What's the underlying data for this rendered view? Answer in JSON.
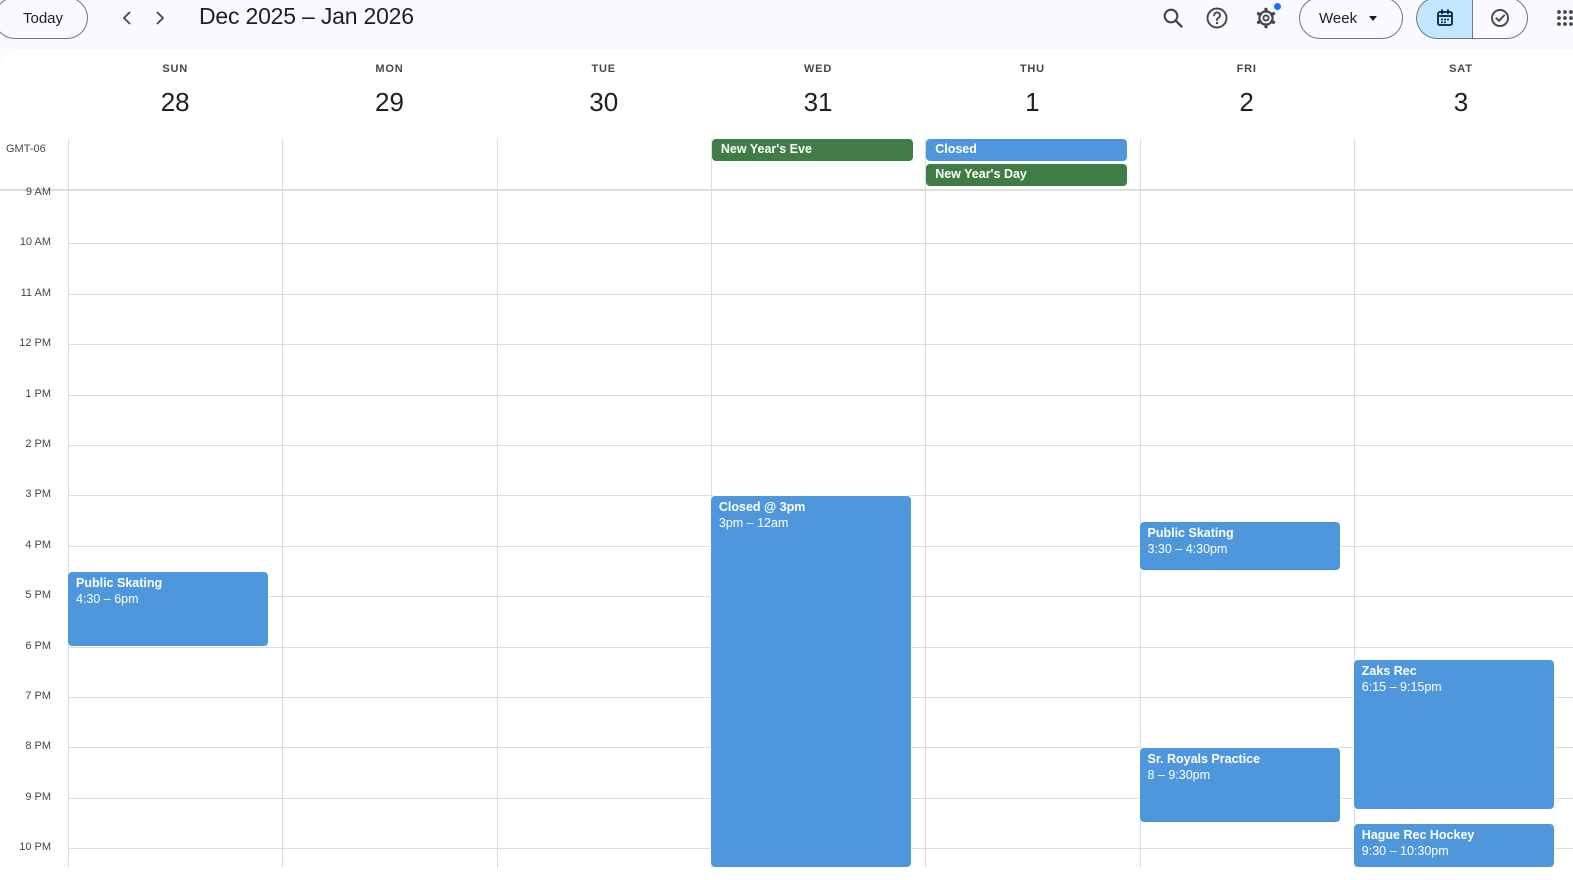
{
  "toolbar": {
    "today_label": "Today",
    "date_range": "Dec 2025 – Jan 2026",
    "view_label": "Week",
    "icons": {
      "prev": "chevron-left-icon",
      "next": "chevron-right-icon",
      "search": "search-icon",
      "help": "help-icon",
      "settings": "gear-icon",
      "calendar": "calendar-icon",
      "tasks": "check-circle-icon",
      "apps": "apps-grid-icon"
    }
  },
  "colors": {
    "accent": "#1a73e8",
    "selected_segment": "#c2e7ff",
    "event_blue": "#4f97dc",
    "event_green": "#3f7c46"
  },
  "timezone": "GMT-06",
  "days": [
    {
      "dow": "SUN",
      "num": "28"
    },
    {
      "dow": "MON",
      "num": "29"
    },
    {
      "dow": "TUE",
      "num": "30"
    },
    {
      "dow": "WED",
      "num": "31"
    },
    {
      "dow": "THU",
      "num": "1"
    },
    {
      "dow": "FRI",
      "num": "2"
    },
    {
      "dow": "SAT",
      "num": "3"
    }
  ],
  "hours": [
    "9 AM",
    "10 AM",
    "11 AM",
    "12 PM",
    "1 PM",
    "2 PM",
    "3 PM",
    "4 PM",
    "5 PM",
    "6 PM",
    "7 PM",
    "8 PM",
    "9 PM",
    "10 PM"
  ],
  "all_day": [
    {
      "day": 3,
      "title": "New Year's Eve",
      "color": "green"
    },
    {
      "day": 4,
      "title": "Closed",
      "color": "blue"
    },
    {
      "day": 4,
      "title": "New Year's Day",
      "color": "green"
    }
  ],
  "events": [
    {
      "day": 0,
      "title": "Public Skating",
      "time": "4:30 – 6pm"
    },
    {
      "day": 3,
      "title": "Closed @ 3pm",
      "time": "3pm – 12am"
    },
    {
      "day": 5,
      "title": "Public Skating",
      "time": "3:30 – 4:30pm"
    },
    {
      "day": 5,
      "title": "Sr. Royals Practice",
      "time": "8 – 9:30pm"
    },
    {
      "day": 6,
      "title": "Zaks Rec",
      "time": "6:15 – 9:15pm"
    },
    {
      "day": 6,
      "title": "Hague Rec Hockey",
      "time": "9:30 – 10:30pm"
    }
  ]
}
